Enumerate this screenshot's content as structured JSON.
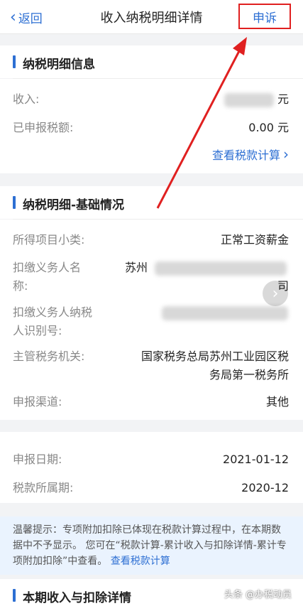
{
  "nav": {
    "back_label": "返回",
    "title": "收入纳税明细详情",
    "appeal_label": "申诉"
  },
  "section1": {
    "title": "纳税明细信息",
    "income_label": "收入:",
    "income_unit": "元",
    "declared_tax_label": "已申报税额:",
    "declared_tax_value": "0.00 元",
    "view_tax_calc_link": "查看税款计算"
  },
  "section2": {
    "title": "纳税明细-基础情况",
    "rows": {
      "income_subcategory_label": "所得项目小类:",
      "income_subcategory_value": "正常工资薪金",
      "withholder_name_label_1": "扣缴义务人名",
      "withholder_name_label_2": "称:",
      "withholder_name_value_1": "苏州",
      "withholder_name_value_2": "司",
      "withholder_id_label_1": "扣缴义务人纳税",
      "withholder_id_label_2": "人识别号:",
      "tax_authority_label": "主管税务机关:",
      "tax_authority_value_1": "国家税务总局苏州工业园区税",
      "tax_authority_value_2": "务局第一税务所",
      "channel_label": "申报渠道:",
      "channel_value": "其他"
    }
  },
  "section3": {
    "declare_date_label": "申报日期:",
    "declare_date_value": "2021-01-12",
    "tax_period_label": "税款所属期:",
    "tax_period_value": "2020-12"
  },
  "notice": {
    "text": "温馨提示：专项附加扣除已体现在税款计算过程中，在本期数据中不予显示。 您可在“税款计算-累计收入与扣除详情-累计专项附加扣除”中查看。",
    "link": "查看税款计算"
  },
  "section4": {
    "title": "本期收入与扣除详情"
  },
  "watermark": "头条 @办税动员",
  "colors": {
    "accent": "#2d6fd3",
    "highlight": "#e02020",
    "notice_bg": "#eaf3fe"
  }
}
